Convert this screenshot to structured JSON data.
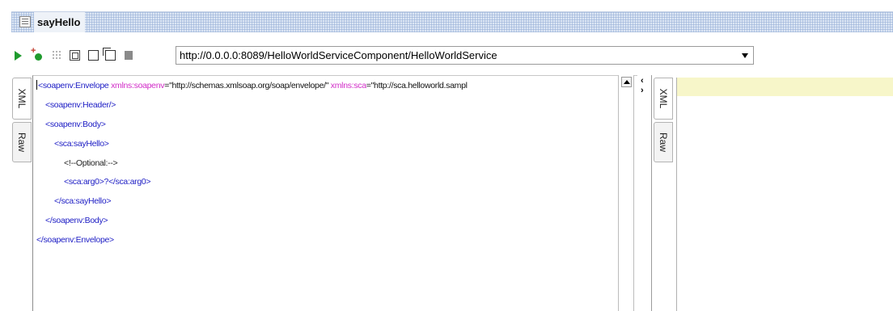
{
  "window": {
    "title": "sayHello"
  },
  "toolbar": {
    "icons": [
      "play-icon",
      "add-request-icon",
      "grid-icon",
      "split-view-icon",
      "single-view-icon",
      "copy-icon",
      "stop-icon"
    ],
    "url": "http://0.0.0.0:8089/HelloWorldServiceComponent/HelloWorldService"
  },
  "request_tabs": {
    "xml": "XML",
    "raw": "Raw"
  },
  "response_tabs": {
    "xml": "XML",
    "raw": "Raw"
  },
  "editor": {
    "line0": {
      "tag": "soapenv:Envelope",
      "attr1": "xmlns:soapenv",
      "val1": "\"http://schemas.xmlsoap.org/soap/envelope/\"",
      "attr2": "xmlns:sca",
      "val2": "\"http://sca.helloworld.sampl"
    },
    "line1": "<soapenv:Header/>",
    "line2": "<soapenv:Body>",
    "line3": "<sca:sayHello>",
    "line4": "<!--Optional:-->",
    "line5": "<sca:arg0>?</sca:arg0>",
    "line6": "</sca:sayHello>",
    "line7": "</soapenv:Body>",
    "line8": "</soapenv:Envelope>"
  },
  "colors": {
    "tag": "#1c1cc4",
    "attribute": "#d22dc8",
    "response_highlight": "#f7f6c9",
    "run_green": "#1f9b2e"
  }
}
